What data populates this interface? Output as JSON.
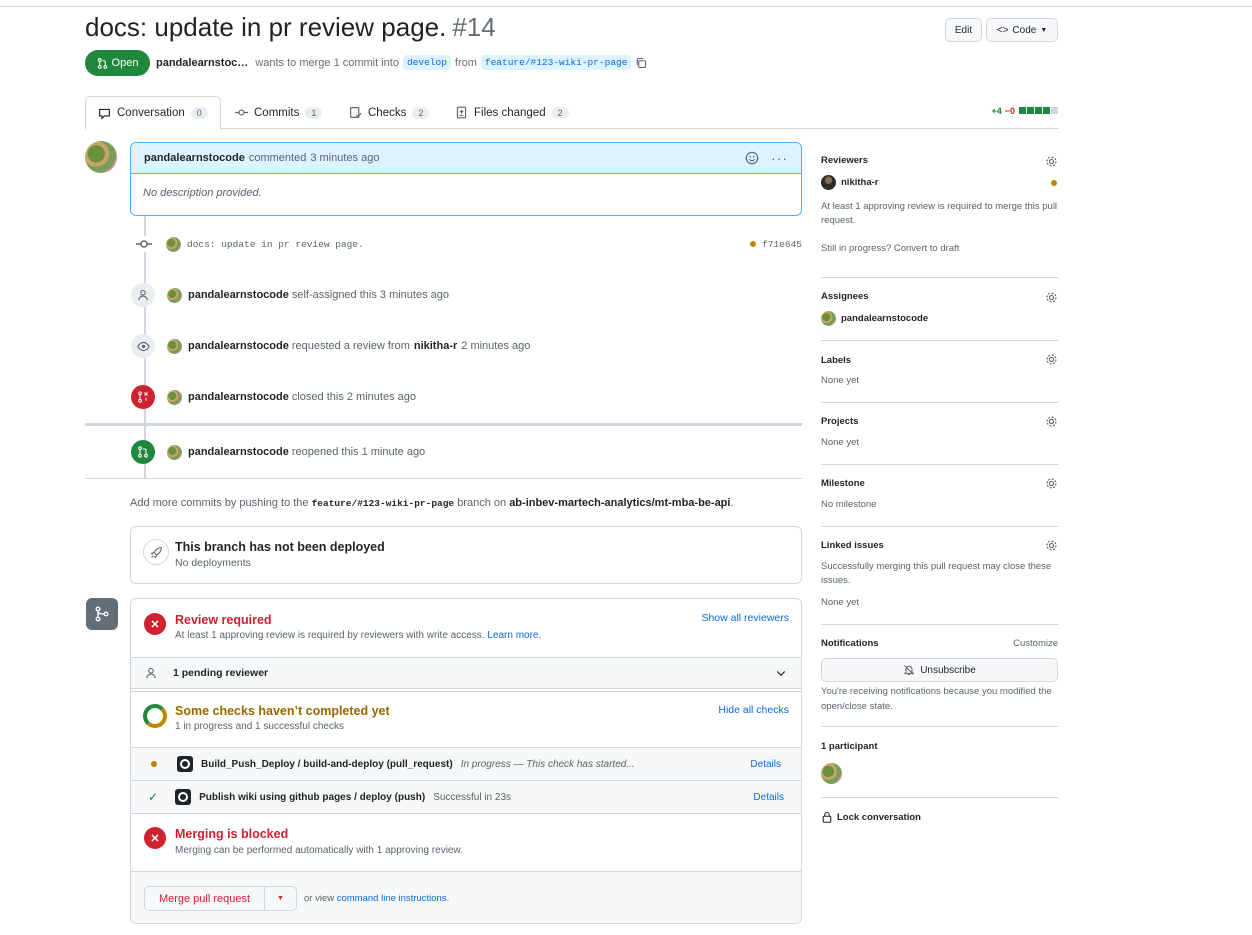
{
  "pr": {
    "title": "docs: update in pr review page.",
    "number": "#14",
    "state": "Open",
    "author": "pandalearnstoc…",
    "merge_text": "wants to merge 1 commit into",
    "base_branch": "develop",
    "from_text": "from",
    "head_branch": "feature/#123-wiki-pr-page"
  },
  "header_buttons": {
    "edit": "Edit",
    "code": "Code"
  },
  "tabs": [
    {
      "label": "Conversation",
      "count": "0"
    },
    {
      "label": "Commits",
      "count": "1"
    },
    {
      "label": "Checks",
      "count": "2"
    },
    {
      "label": "Files changed",
      "count": "2"
    }
  ],
  "diffstat": {
    "additions": "+4",
    "deletions": "−0"
  },
  "comment": {
    "author": "pandalearnstocode",
    "action": "commented",
    "time": "3 minutes ago",
    "body": "No description provided."
  },
  "events": {
    "commit": {
      "message": "docs: update in pr review page.",
      "sha": "f71e645"
    },
    "assigned": {
      "actor": "pandalearnstocode",
      "text": "self-assigned this 3 minutes ago"
    },
    "review_req": {
      "actor": "pandalearnstocode",
      "text1": "requested a review from",
      "reviewer": "nikitha-r",
      "text2": "2 minutes ago"
    },
    "closed": {
      "actor": "pandalearnstocode",
      "text": "closed this 2 minutes ago"
    },
    "reopened": {
      "actor": "pandalearnstocode",
      "text": "reopened this 1 minute ago"
    }
  },
  "push_info": {
    "text1": "Add more commits by pushing to the",
    "branch": "feature/#123-wiki-pr-page",
    "text2": "branch on",
    "repo": "ab-inbev-martech-analytics/mt-mba-be-api",
    "text3": "."
  },
  "deploy": {
    "title": "This branch has not been deployed",
    "subtitle": "No deployments"
  },
  "merge_box": {
    "review_title": "Review required",
    "review_desc": "At least 1 approving review is required by reviewers with write access.",
    "learn_more": "Learn more.",
    "show_reviewers": "Show all reviewers",
    "pending": "1 pending reviewer",
    "checks_title": "Some checks haven’t completed yet",
    "checks_desc": "1 in progress and 1 successful checks",
    "hide_checks": "Hide all checks",
    "check1_name": "Build_Push_Deploy / build-and-deploy (pull_request)",
    "check1_status": "In progress — This check has started...",
    "check2_name": "Publish wiki using github pages / deploy (push)",
    "check2_status": "Successful in 23s",
    "details": "Details",
    "blocked_title": "Merging is blocked",
    "blocked_desc": "Merging can be performed automatically with 1 approving review.",
    "merge_button": "Merge pull request",
    "or_view": "or view",
    "cli": "command line instructions",
    "cli_end": "."
  },
  "sidebar": {
    "reviewers_title": "Reviewers",
    "reviewer": "nikitha-r",
    "reviewer_note": "At least 1 approving review is required to merge this pull request.",
    "draft_note": "Still in progress? Convert to draft",
    "assignees_title": "Assignees",
    "assignee": "pandalearnstocode",
    "labels_title": "Labels",
    "labels_value": "None yet",
    "projects_title": "Projects",
    "projects_value": "None yet",
    "milestone_title": "Milestone",
    "milestone_value": "No milestone",
    "linked_title": "Linked issues",
    "linked_note": "Successfully merging this pull request may close these issues.",
    "linked_value": "None yet",
    "notifications_title": "Notifications",
    "customize": "Customize",
    "unsubscribe": "Unsubscribe",
    "notif_note": "You're receiving notifications because you modified the open/close state.",
    "participants": "1 participant",
    "lock": "Lock conversation"
  },
  "colors": {
    "green": "#1f883d",
    "red": "#cf222e",
    "blue": "#0969da",
    "pending": "#bf8700"
  }
}
